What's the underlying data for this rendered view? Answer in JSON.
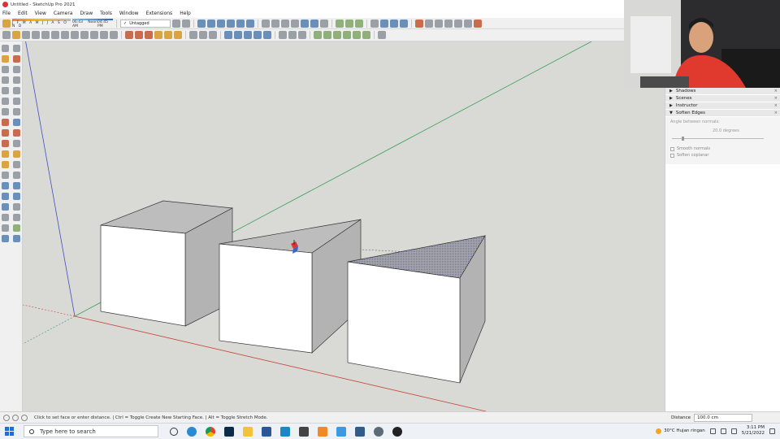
{
  "window": {
    "title": "Untitled - SketchUp Pro 2021"
  },
  "menu": [
    "File",
    "Edit",
    "View",
    "Camera",
    "Draw",
    "Tools",
    "Window",
    "Extensions",
    "Help"
  ],
  "shadow_settings": {
    "months": "J F M A M J J A S O N D",
    "times": [
      "06:43 AM",
      "Noon",
      "04:45 PM"
    ]
  },
  "tag_select": {
    "value": "Untagged"
  },
  "tray": {
    "panels": [
      {
        "label": "Shadows",
        "state": "collapsed"
      },
      {
        "label": "Scenes",
        "state": "collapsed"
      },
      {
        "label": "Instructor",
        "state": "collapsed"
      },
      {
        "label": "Soften Edges",
        "state": "expanded"
      }
    ],
    "soften_edges": {
      "angle_label": "Angle between normals:",
      "angle_value": "20.0  degrees",
      "smooth_normals": "Smooth normals",
      "soften_coplanar": "Soften coplanar"
    }
  },
  "status": {
    "message": "Click to set face or enter distance. | Ctrl = Toggle Create New Starting Face. | Alt = Toggle Stretch Mode.",
    "measurement_label": "Distance",
    "measurement_value": "100.0 cm"
  },
  "taskbar": {
    "search_placeholder": "Type here to search",
    "weather": "30°C  Hujan ringan",
    "time": "3:11 PM",
    "date": "5/21/2022",
    "apps": [
      "task-view",
      "edge",
      "chrome",
      "photoshop",
      "file-explorer",
      "word",
      "sketchup",
      "store",
      "vlc",
      "onedrive",
      "terminal",
      "settings",
      "obs"
    ]
  },
  "colors": {
    "viewport_bg": "#d9d9d6",
    "face_light": "#ffffff",
    "face_shadow": "#b3b3b3",
    "face_top": "#bdbdbd",
    "axis_red": "#c44a3b",
    "axis_green": "#3aa05a",
    "axis_blue": "#4050c0"
  }
}
